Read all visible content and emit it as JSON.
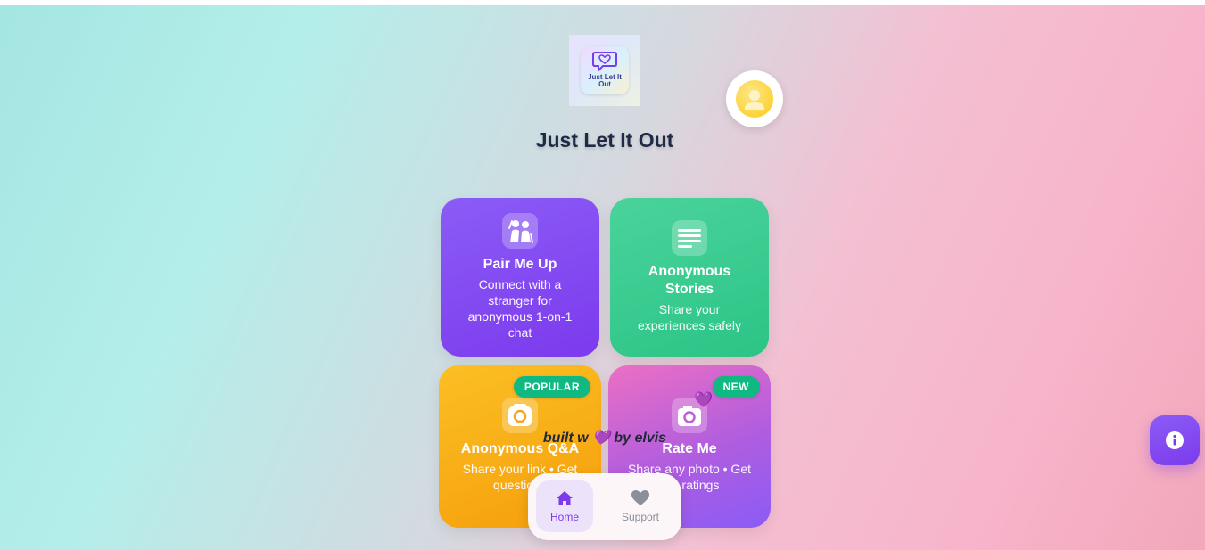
{
  "app": {
    "title": "Just Let It Out",
    "logo_text": "Just Let It Out"
  },
  "cards": [
    {
      "title": "Pair Me Up",
      "description": "Connect with a stranger for anonymous 1-on-1 chat",
      "icon": "couple-icon",
      "color": "#7c3aed"
    },
    {
      "title": "Anonymous Stories",
      "description": "Share your experiences safely",
      "icon": "document-lines-icon",
      "color": "#34d399"
    },
    {
      "title": "Anonymous Q&A",
      "description": "Share your link • Get questions",
      "icon": "camera-icon",
      "badge": "POPULAR",
      "color": "#f59e0b"
    },
    {
      "title": "Rate Me",
      "description": "Share any photo • Get live ratings",
      "icon": "camera-heart-icon",
      "badge": "NEW",
      "color": "#c05ddf"
    }
  ],
  "footer": {
    "built_by": "built w 💜 by elvis"
  },
  "nav": {
    "items": [
      {
        "label": "Home",
        "icon": "home-icon",
        "active": true
      },
      {
        "label": "Support",
        "icon": "heart-icon",
        "active": false
      }
    ]
  },
  "colors": {
    "accent": "#7c3aed",
    "badge": "#10b981"
  }
}
